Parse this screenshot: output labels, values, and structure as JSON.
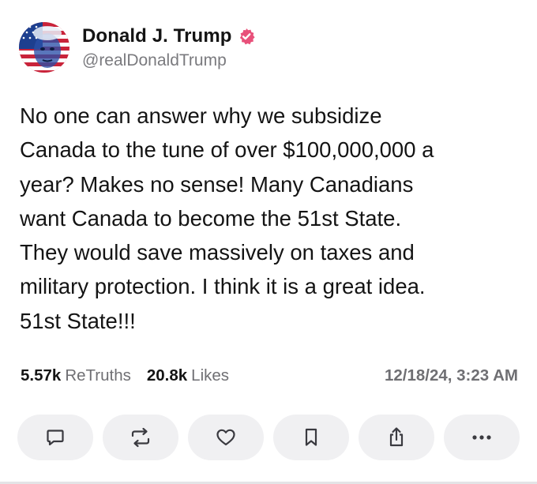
{
  "post": {
    "author": {
      "display_name": "Donald J. Trump",
      "handle": "@realDonaldTrump",
      "verified_icon": "verified-badge-icon",
      "verified_color": "#e8507a"
    },
    "text": "No one can answer why we subsidize\nCanada to the tune of over $100,000,000 a\nyear? Makes no sense! Many Canadians\nwant Canada to become the 51st State.\nThey would save massively on taxes and\nmilitary protection. I think it is a great idea.\n51st State!!!",
    "stats": {
      "retruths_count": "5.57k",
      "retruths_label": "ReTruths",
      "likes_count": "20.8k",
      "likes_label": "Likes",
      "timestamp": "12/18/24, 3:23 AM"
    },
    "actions": [
      {
        "icon": "comment-icon"
      },
      {
        "icon": "retruth-icon"
      },
      {
        "icon": "heart-icon"
      },
      {
        "icon": "bookmark-icon"
      },
      {
        "icon": "share-icon"
      },
      {
        "icon": "more-icon"
      }
    ]
  }
}
